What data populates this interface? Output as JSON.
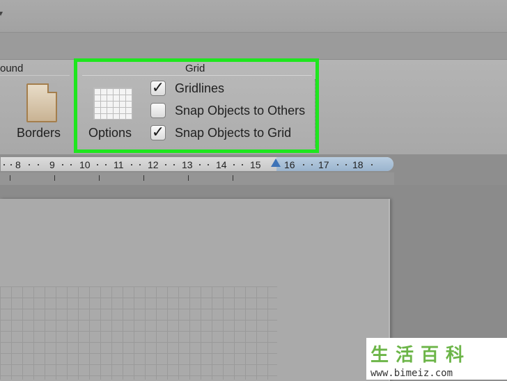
{
  "ribbon": {
    "background_group": {
      "label_partial": "ound"
    },
    "borders_label": "Borders",
    "options_label": "Options",
    "grid_group": {
      "title": "Grid",
      "highlight_color": "#1ee61e",
      "checkboxes": [
        {
          "label": "Gridlines",
          "checked": true,
          "check_glyph": "✓"
        },
        {
          "label": "Snap Objects to Others",
          "checked": false,
          "check_glyph": ""
        },
        {
          "label": "Snap Objects to Grid",
          "checked": true,
          "check_glyph": "✓"
        }
      ]
    }
  },
  "ruler": {
    "numbers": [
      "8",
      "9",
      "10",
      "11",
      "12",
      "13",
      "14",
      "15",
      "16",
      "17",
      "18"
    ],
    "marker_color": "#3e73b7"
  },
  "watermark": {
    "chinese": "生活百科",
    "url": "www.bimeiz.com"
  },
  "icons": {
    "borders": "page-border-icon",
    "options": "grid-options-icon",
    "marker": "tab-stop-marker-icon"
  }
}
